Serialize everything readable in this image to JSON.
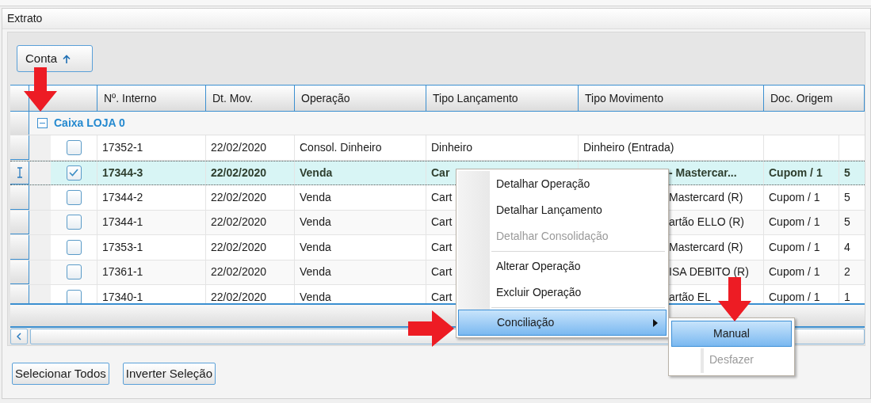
{
  "panel": {
    "title": "Extrato"
  },
  "group_by_button": {
    "label": "Conta"
  },
  "table": {
    "columns": [
      "Nº. Interno",
      "Dt. Mov.",
      "Operação",
      "Tipo Lançamento",
      "Tipo Movimento",
      "Doc. Origem"
    ],
    "group": {
      "label": "Caixa LOJA 0",
      "expanded": true
    },
    "rows": [
      {
        "checked": false,
        "selected": false,
        "partial": false,
        "cells": [
          "17352-1",
          "22/02/2020",
          "Consol. Dinheiro",
          "Dinheiro",
          "Dinheiro (Entrada)",
          "",
          ""
        ]
      },
      {
        "checked": true,
        "selected": true,
        "partial": true,
        "cells": [
          "17344-3",
          "22/02/2020",
          "Venda",
          "Car",
          "- Mastercar...",
          "Cupom / 1",
          "5"
        ]
      },
      {
        "checked": false,
        "selected": false,
        "partial": true,
        "cells": [
          "17344-2",
          "22/02/2020",
          "Venda",
          "Cart",
          "Mastercard (R)",
          "Cupom / 1",
          "5"
        ]
      },
      {
        "checked": false,
        "selected": false,
        "partial": true,
        "cells": [
          "17344-1",
          "22/02/2020",
          "Venda",
          "Cart",
          "artão ELLO (R)",
          "Cupom / 1",
          "5"
        ]
      },
      {
        "checked": false,
        "selected": false,
        "partial": true,
        "cells": [
          "17353-1",
          "22/02/2020",
          "Venda",
          "Cart",
          "Mastercard (R)",
          "Cupom / 1",
          "4"
        ]
      },
      {
        "checked": false,
        "selected": false,
        "partial": true,
        "cells": [
          "17361-1",
          "22/02/2020",
          "Venda",
          "Cart",
          "ISA DEBITO (R)",
          "Cupom / 1",
          "2"
        ]
      },
      {
        "checked": false,
        "selected": false,
        "partial": true,
        "cells": [
          "17340-1",
          "22/02/2020",
          "Venda",
          "Cart",
          "artão EL",
          "Cupom / 1",
          "1"
        ]
      }
    ]
  },
  "buttons": [
    "Selecionar Todos",
    "Inverter Seleção"
  ],
  "context_menu": {
    "items": [
      {
        "kind": "item",
        "label": "Detalhar Operação",
        "disabled": false,
        "selected": false
      },
      {
        "kind": "item",
        "label": "Detalhar Lançamento",
        "disabled": false,
        "selected": false
      },
      {
        "kind": "item",
        "label": "Detalhar Consolidação",
        "disabled": true,
        "selected": false
      },
      {
        "kind": "separator"
      },
      {
        "kind": "item",
        "label": "Alterar Operação",
        "disabled": false,
        "selected": false
      },
      {
        "kind": "item",
        "label": "Excluir Operação",
        "disabled": false,
        "selected": false
      },
      {
        "kind": "separator"
      },
      {
        "kind": "submenu",
        "label": "Conciliação",
        "disabled": false,
        "selected": true
      }
    ]
  },
  "submenu": {
    "items": [
      {
        "label": "Manual",
        "disabled": false,
        "selected": true
      },
      {
        "label": "Desfazer",
        "disabled": true,
        "selected": false
      }
    ]
  }
}
